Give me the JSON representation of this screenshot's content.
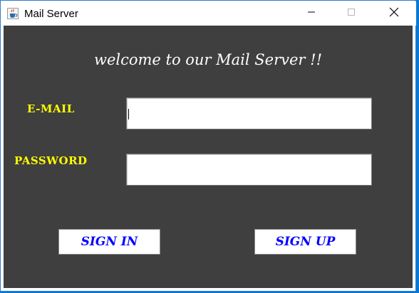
{
  "window": {
    "title": "Mail Server",
    "icon": "java-coffee-icon",
    "controls": [
      "minimize-icon",
      "maximize-icon",
      "close-icon"
    ]
  },
  "main": {
    "welcome_text": "welcome to our Mail Server !!",
    "email_label": "E-MAIL",
    "email_value": "",
    "password_label": "PASSWORD",
    "password_value": "",
    "sign_in_label": "SIGN IN",
    "sign_up_label": "SIGN UP"
  },
  "colors": {
    "background": "#3f3f3f",
    "label": "#ffff00",
    "button_text": "#0000ff",
    "welcome_text": "#ffffff"
  }
}
